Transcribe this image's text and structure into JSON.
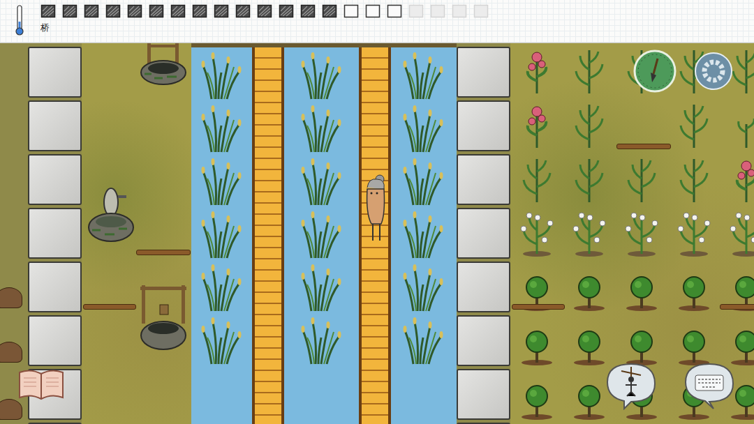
{
  "hud": {
    "location_label": "桥",
    "temperature": {
      "level": 0.3
    },
    "food_pips": [
      {
        "state": "full"
      },
      {
        "state": "full"
      },
      {
        "state": "full"
      },
      {
        "state": "full"
      },
      {
        "state": "full"
      },
      {
        "state": "full"
      },
      {
        "state": "full"
      },
      {
        "state": "full"
      },
      {
        "state": "full"
      },
      {
        "state": "full"
      },
      {
        "state": "full"
      },
      {
        "state": "full"
      },
      {
        "state": "full"
      },
      {
        "state": "full"
      },
      {
        "state": "empty"
      },
      {
        "state": "empty"
      },
      {
        "state": "empty"
      },
      {
        "state": "ghost"
      },
      {
        "state": "ghost"
      },
      {
        "state": "ghost"
      },
      {
        "state": "ghost"
      }
    ]
  },
  "field": {
    "rows": [
      {
        "plants": [
          "rose",
          "corn",
          "corn",
          "corn",
          "corn"
        ]
      },
      {
        "plants": [
          "rose",
          "corn",
          "empty",
          "corn",
          "sprout"
        ]
      },
      {
        "plants": [
          "corn",
          "corn",
          "corn",
          "corn",
          "rose"
        ]
      },
      {
        "plants": [
          "cotton",
          "cotton",
          "cotton",
          "cotton",
          "cotton"
        ]
      },
      {
        "plants": [
          "bush",
          "bush",
          "bush",
          "bush",
          "bush"
        ]
      },
      {
        "plants": [
          "bush",
          "bush",
          "bush",
          "bush",
          "bush"
        ]
      },
      {
        "plants": [
          "bush",
          "bush",
          "bush",
          "bush",
          "bush"
        ]
      }
    ]
  }
}
